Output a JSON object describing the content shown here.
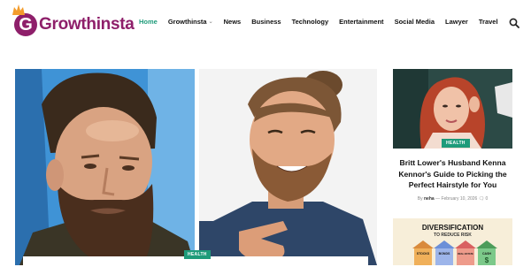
{
  "brand": {
    "name": "Growthinsta",
    "logo_letter": "G"
  },
  "nav": {
    "items": [
      {
        "label": "Home",
        "active": true
      },
      {
        "label": "Growthinsta",
        "dropdown": true
      },
      {
        "label": "News"
      },
      {
        "label": "Business"
      },
      {
        "label": "Technology"
      },
      {
        "label": "Entertainment"
      },
      {
        "label": "Social Media"
      },
      {
        "label": "Lawyer"
      },
      {
        "label": "Travel"
      }
    ]
  },
  "hero": {
    "badge": "HEALTH"
  },
  "side_article": {
    "badge": "HEALTH",
    "title": "Britt Lower's Husband Kenna Kennor's Guide to Picking the Perfect Hairstyle for You",
    "by": "By",
    "author": "neha",
    "date": "February 10, 2026",
    "comments": "0"
  },
  "promo": {
    "title": "DIVERSIFICATION",
    "subtitle": "TO REDUCE RISK",
    "labels": [
      "STOCKS",
      "BONDS",
      "REAL ESTATE",
      "CASH"
    ]
  },
  "colors": {
    "brand": "#8e1f6a",
    "accent": "#1e9b7a"
  }
}
